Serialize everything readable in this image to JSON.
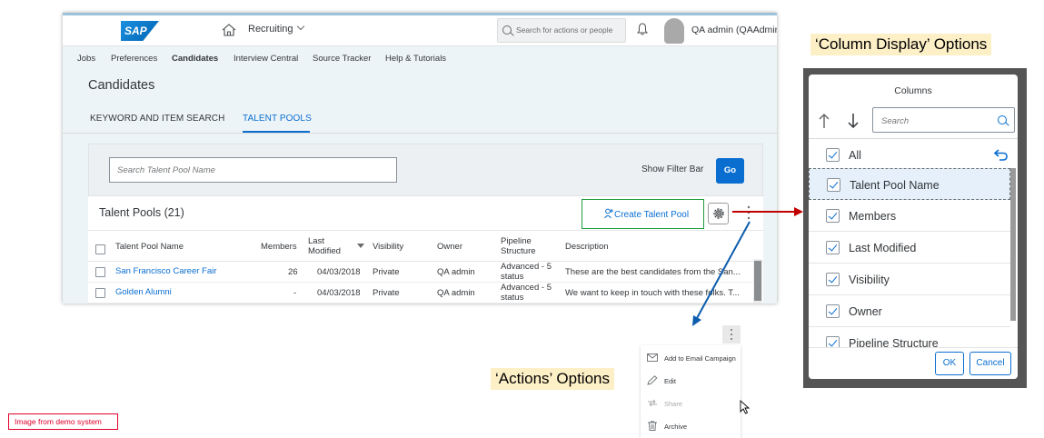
{
  "shell": {
    "logo": "SAP",
    "module_label": "Recruiting",
    "search_placeholder": "Search for actions or people",
    "user_name": "QA admin (QAAdmin)"
  },
  "nav": {
    "items": [
      {
        "label": "Jobs"
      },
      {
        "label": "Preferences"
      },
      {
        "label": "Candidates",
        "active": true
      },
      {
        "label": "Interview Central"
      },
      {
        "label": "Source Tracker"
      },
      {
        "label": "Help & Tutorials"
      }
    ]
  },
  "page": {
    "title": "Candidates",
    "tabs": [
      {
        "label": "KEYWORD AND ITEM SEARCH",
        "active": false
      },
      {
        "label": "TALENT POOLS",
        "active": true
      }
    ]
  },
  "filter": {
    "placeholder": "Search Talent Pool Name",
    "show_filter_bar": "Show Filter Bar",
    "go": "Go"
  },
  "pools": {
    "title": "Talent Pools (21)",
    "create_label": "Create Talent Pool",
    "columns": {
      "name": "Talent Pool Name",
      "members": "Members",
      "last_modified_1": "Last",
      "last_modified_2": "Modified",
      "visibility": "Visibility",
      "owner": "Owner",
      "pipeline_1": "Pipeline",
      "pipeline_2": "Structure",
      "description": "Description"
    },
    "rows": [
      {
        "name": "San Francisco Career Fair",
        "members": "26",
        "modified": "04/03/2018",
        "visibility": "Private",
        "owner": "QA admin",
        "pipeline_1": "Advanced - 5",
        "pipeline_2": "status",
        "description": "These are the best candidates from the San..."
      },
      {
        "name": "Golden Alumni",
        "members": "-",
        "modified": "04/03/2018",
        "visibility": "Private",
        "owner": "QA admin",
        "pipeline_1": "Advanced - 5",
        "pipeline_2": "status",
        "description": "We want to keep in touch with these folks. T..."
      }
    ]
  },
  "annotations": {
    "column_display": "‘Column Display’ Options",
    "actions": "‘Actions’ Options",
    "demo_tag": "Image from demo system"
  },
  "columns_dialog": {
    "title": "Columns",
    "search_placeholder": "Search",
    "items": [
      {
        "label": "All",
        "checked": true
      },
      {
        "label": "Talent Pool Name",
        "checked": true,
        "selected": true
      },
      {
        "label": "Members",
        "checked": true
      },
      {
        "label": "Last Modified",
        "checked": true
      },
      {
        "label": "Visibility",
        "checked": true
      },
      {
        "label": "Owner",
        "checked": true
      },
      {
        "label": "Pipeline Structure",
        "checked": true
      }
    ],
    "ok": "OK",
    "cancel": "Cancel"
  },
  "actions_menu": {
    "items": [
      {
        "label": "Add to Email Campaign",
        "icon": "envelope-icon",
        "enabled": true
      },
      {
        "label": "Edit",
        "icon": "pencil-icon",
        "enabled": true
      },
      {
        "label": "Share",
        "icon": "share-icon",
        "enabled": false
      },
      {
        "label": "Archive",
        "icon": "trash-icon",
        "enabled": true
      }
    ]
  },
  "colors": {
    "accent": "#0a6ed1",
    "highlight_border": "#1d9d3c",
    "arrow_red": "#c00000",
    "arrow_blue": "#0b5cad"
  }
}
